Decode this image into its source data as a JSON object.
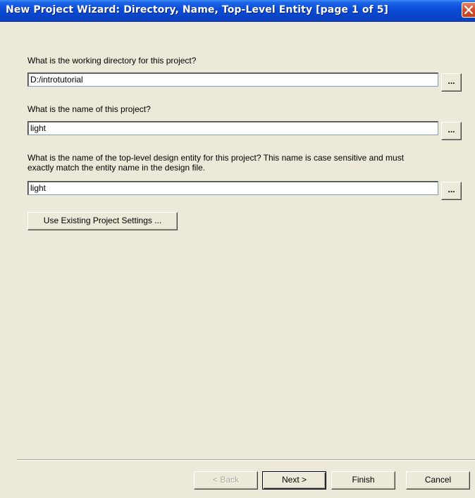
{
  "window": {
    "title": "New Project Wizard: Directory, Name, Top-Level Entity [page 1 of 5]"
  },
  "form": {
    "directory_label": "What is the working directory for this project?",
    "directory_value": "D:/introtutorial",
    "name_label": "What is the name of this project?",
    "name_value": "light",
    "entity_label_line1": "What is the name of the top-level design entity for this project? This name is case sensitive and must",
    "entity_label_line2": "exactly match the entity name in the design file.",
    "entity_value": "light",
    "browse_label": "...",
    "use_existing_label": "Use Existing Project Settings ..."
  },
  "footer": {
    "back_label": "< Back",
    "next_label": "Next >",
    "finish_label": "Finish",
    "cancel_label": "Cancel"
  },
  "colors": {
    "dialog_bg": "#ECE9D8",
    "titlebar_blue": "#0A4CD6",
    "close_red": "#D8512F"
  }
}
